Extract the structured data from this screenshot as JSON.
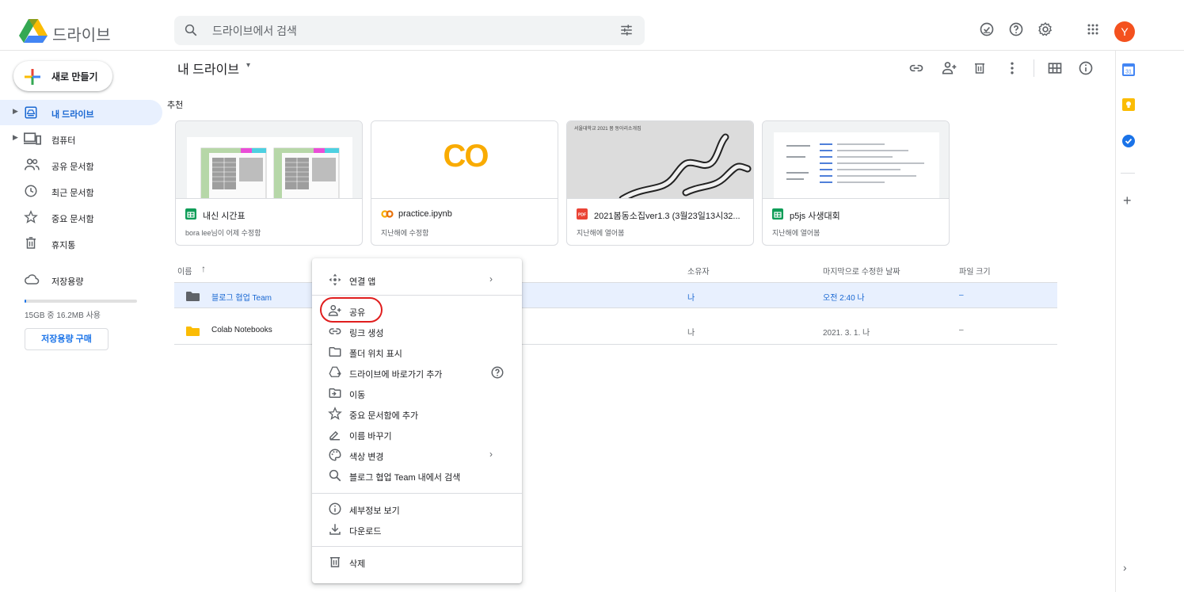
{
  "app": {
    "name": "드라이브",
    "search_placeholder": "드라이브에서 검색",
    "avatar_letter": "Y",
    "colors": {
      "accent": "#1a73e8",
      "selected_bg": "#e8f0fe",
      "highlight": "#e01e1e",
      "avatar": "#f4511e"
    }
  },
  "sidebar": {
    "new_label": "새로 만들기",
    "items": [
      {
        "label": "내 드라이브",
        "icon": "drive-icon"
      },
      {
        "label": "컴퓨터",
        "icon": "computer-icon"
      },
      {
        "label": "공유 문서함",
        "icon": "people-icon"
      },
      {
        "label": "최근 문서함",
        "icon": "clock-icon"
      },
      {
        "label": "중요 문서함",
        "icon": "star-icon"
      },
      {
        "label": "휴지통",
        "icon": "trash-icon"
      },
      {
        "label": "저장용량",
        "icon": "cloud-icon"
      }
    ],
    "storage_text": "15GB 중 16.2MB 사용",
    "storage_fraction": 0.001,
    "buy_label": "저장용량 구매"
  },
  "main": {
    "title": "내 드라이브",
    "title_caret": "▾",
    "suggested_label": "추천",
    "cards": [
      {
        "title": "내신 시간표",
        "subtitle": "bora lee님이 어제 수정함",
        "file_icon": "sheets-icon"
      },
      {
        "title": "practice.ipynb",
        "subtitle": "지난해에 수정함",
        "file_icon": "colab-icon",
        "thumb_text": "CO"
      },
      {
        "title": "2021봄동소집ver1.3 (3월23일13시32...",
        "subtitle": "지난해에 열어봄",
        "file_icon": "pdf-icon",
        "thumb_text": "서울대학교 2021 봄 동아리소개집"
      },
      {
        "title": "p5js 사생대회",
        "subtitle": "지난해에 열어봄",
        "file_icon": "sheets-icon"
      }
    ],
    "columns": {
      "name": "이름",
      "sort_arrow": "↑",
      "owner": "소유자",
      "modified": "마지막으로 수정한 날짜",
      "size": "파일 크기"
    },
    "rows": [
      {
        "name": "블로그 협업 Team",
        "owner": "나",
        "modified": "오전 2:40 나",
        "size": "–"
      },
      {
        "name": "Colab Notebooks",
        "owner": "나",
        "modified": "2021. 3. 1. 나",
        "size": "–"
      }
    ]
  },
  "context_menu": {
    "items": [
      {
        "label": "연결 앱",
        "icon": "open-with-icon",
        "arrow": "›"
      },
      {
        "label": "공유",
        "icon": "person-add-icon"
      },
      {
        "label": "링크 생성",
        "icon": "link-icon"
      },
      {
        "label": "폴더 위치 표시",
        "icon": "folder-outline-icon"
      },
      {
        "label": "드라이브에 바로가기 추가",
        "icon": "drive-shortcut-icon"
      },
      {
        "label": "이동",
        "icon": "move-icon"
      },
      {
        "label": "중요 문서함에 추가",
        "icon": "star-icon"
      },
      {
        "label": "이름 바꾸기",
        "icon": "edit-icon"
      },
      {
        "label": "색상 변경",
        "icon": "palette-icon",
        "arrow": "›"
      },
      {
        "label": "블로그 협업 Team 내에서 검색",
        "icon": "search-icon"
      },
      {
        "label": "세부정보 보기",
        "icon": "info-icon"
      },
      {
        "label": "다운로드",
        "icon": "download-icon"
      },
      {
        "label": "삭제",
        "icon": "trash-icon"
      }
    ]
  },
  "side_panel": {
    "plus": "+",
    "expand": "›"
  }
}
